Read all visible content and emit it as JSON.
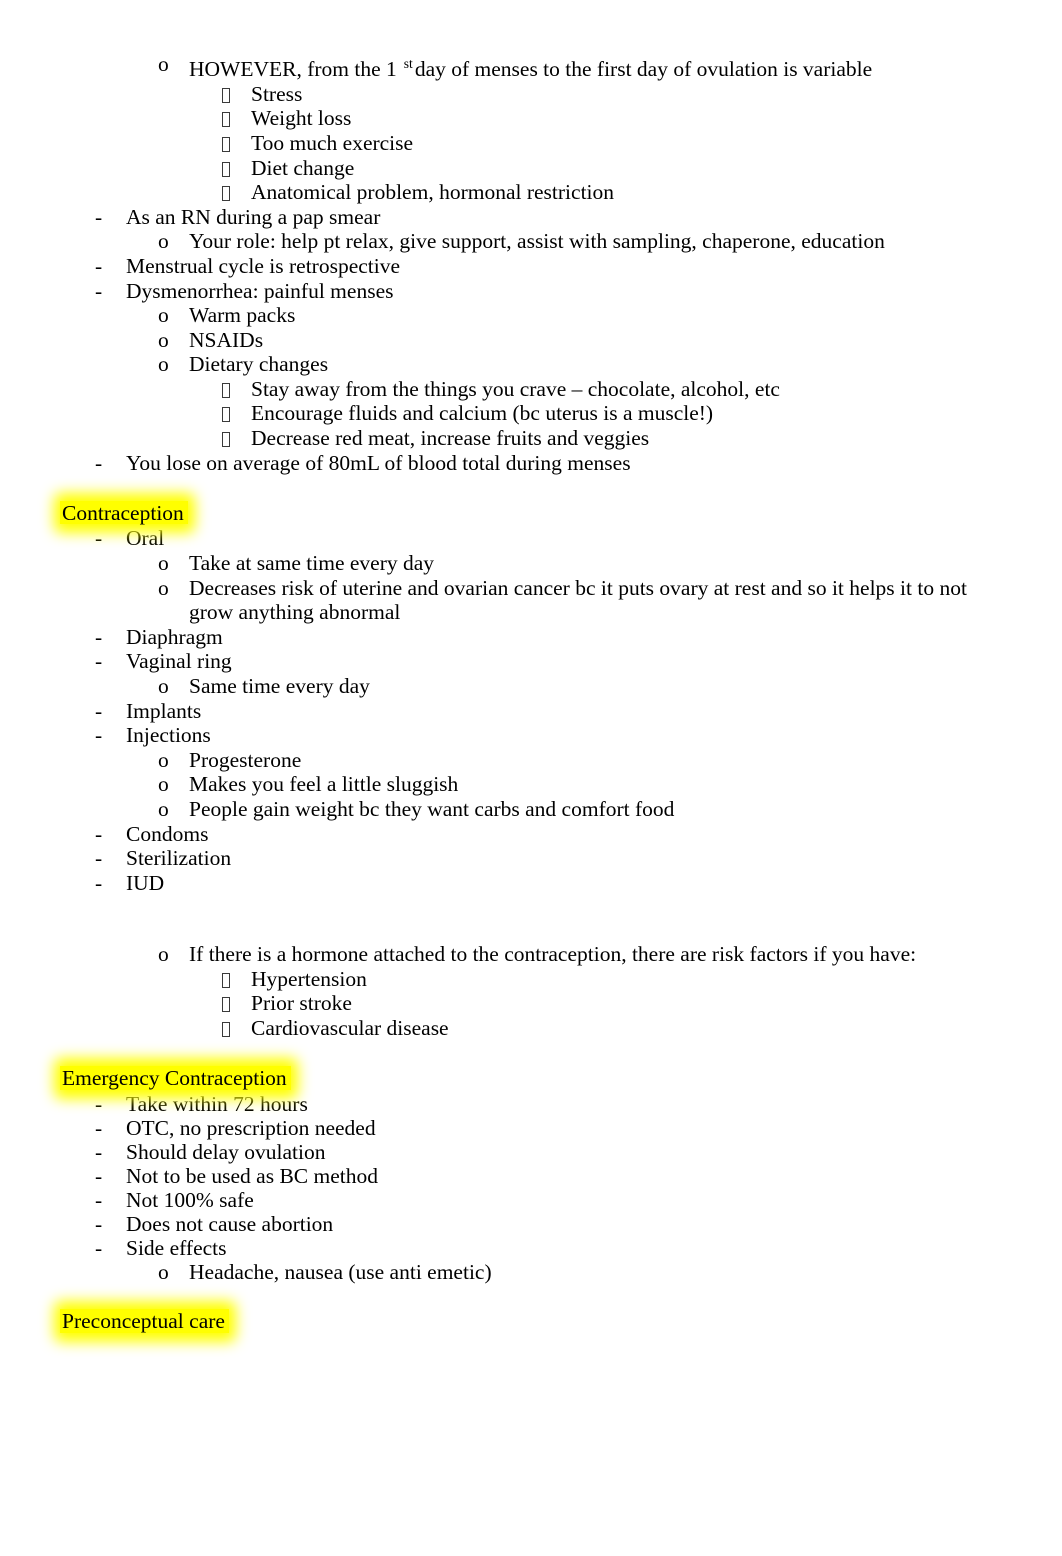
{
  "document": {
    "page_background": "#ffffff",
    "text_color": "#000000",
    "highlight_color": "#ffff00",
    "bullet_markers": {
      "level1": "-",
      "level2": "o",
      "level3": "missing-glyph-box"
    }
  },
  "content": {
    "block1": {
      "l1": "HOWEVER, from the 1",
      "l1_sup": "st",
      "l1_rest": "day of menses to the first day of ovulation is variable",
      "l2": "Stress",
      "l3": "Weight loss",
      "l4": "Too much exercise",
      "l5": "Diet change",
      "l6": "Anatomical problem, hormonal restriction",
      "l7": "As an RN during a pap smear",
      "l8": "Your role: help pt relax, give support, assist with sampling, chaperone, education",
      "l9": "Menstrual cycle is retrospective",
      "l10": "Dysmenorrhea: painful menses",
      "l11": "Warm packs",
      "l12": "NSAIDs",
      "l13": "Dietary changes",
      "l14": "Stay away from the things you crave – chocolate, alcohol, etc",
      "l15": "Encourage fluids and calcium (bc uterus is a muscle!)",
      "l16": "Decrease red meat, increase fruits and veggies",
      "l17": "You lose on average of 80mL of blood total during menses"
    },
    "contraception": {
      "heading": "Contraception",
      "l1": "Oral",
      "l2": "Take at same time every day",
      "l3": "Decreases risk of uterine and ovarian cancer bc it puts ovary at rest and so it helps it to not grow anything abnormal",
      "l4": "Diaphragm",
      "l5": "Vaginal ring",
      "l6": "Same time every day",
      "l7": "Implants",
      "l8": "Injections",
      "l9": "Progesterone",
      "l10": "Makes you feel a little sluggish",
      "l11": "People gain weight bc they want carbs and comfort food",
      "l12": "Condoms",
      "l13": "Sterilization",
      "l14": "IUD",
      "l15": "If there is a hormone attached to the contraception, there are risk factors if you have:",
      "l16": "Hypertension",
      "l17": "Prior stroke",
      "l18": "Cardiovascular disease"
    },
    "emergency_contraception": {
      "heading": "Emergency Contraception",
      "l1": "Take within 72 hours",
      "l2": "OTC, no prescription needed",
      "l3": "Should delay ovulation",
      "l4": "Not to be used as BC method",
      "l5": "Not 100% safe",
      "l6": "Does not cause abortion",
      "l7": "Side effects",
      "l8": "Headache, nausea (use anti emetic)"
    },
    "preconceptual": {
      "heading": "Preconceptual care"
    }
  }
}
